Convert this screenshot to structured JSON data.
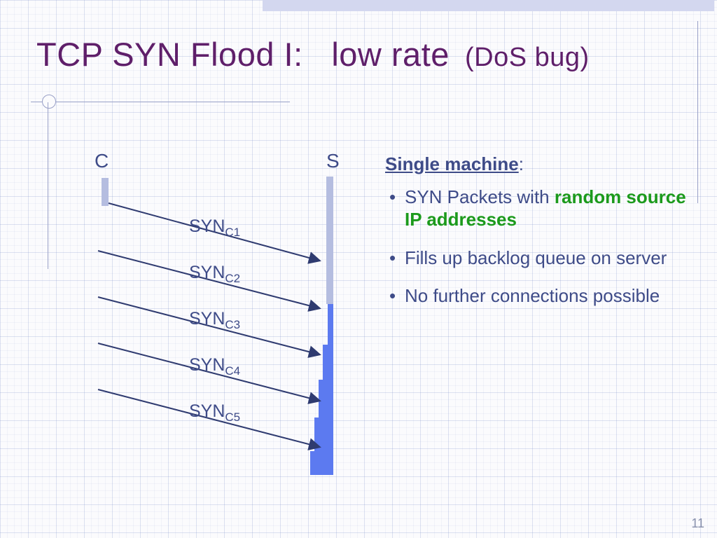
{
  "title": {
    "main": "TCP SYN Flood I:   low rate",
    "sub": "  (DoS bug)"
  },
  "diagram": {
    "client_label": "C",
    "server_label": "S",
    "arrows": [
      {
        "label": "SYN",
        "sub": "C1"
      },
      {
        "label": "SYN",
        "sub": "C2"
      },
      {
        "label": "SYN",
        "sub": "C3"
      },
      {
        "label": "SYN",
        "sub": "C4"
      },
      {
        "label": "SYN",
        "sub": "C5"
      }
    ]
  },
  "panel": {
    "heading": "Single machine",
    "punct": ":",
    "bullets": [
      {
        "lead": "SYN Packets with ",
        "highlight": "random source IP addresses",
        "tail": ""
      },
      {
        "text": "Fills up backlog queue on server"
      },
      {
        "text": "No further connections possible"
      }
    ]
  },
  "page_number": "11"
}
